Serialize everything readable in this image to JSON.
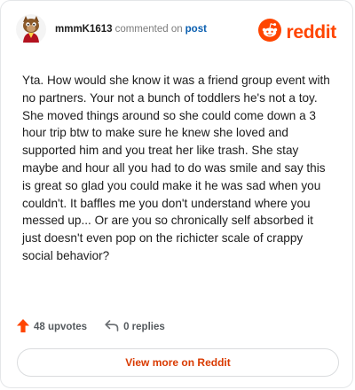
{
  "comment": {
    "author": "mmmK1613",
    "action_text": "commented on",
    "post_link": "post",
    "body": "Yta. How would she know it was a friend group event with no partners. Your not a bunch of toddlers he's not a toy. She moved things around so she could come down a 3 hour trip btw to make sure he knew she loved and supported him and you treat her like trash. She stay maybe and hour all you had to do was smile and say this is great so glad you could make it he was sad when you couldn't. It baffles me you don't understand where you messed up... Or are you so chronically self absorbed it just doesn't even pop on the richicter scale of crappy social behavior?",
    "upvotes_label": "48 upvotes",
    "replies_label": "0 replies"
  },
  "brand": {
    "wordmark": "reddit",
    "color": "#ff4500"
  },
  "actions": {
    "view_more_label": "View more on Reddit"
  },
  "icons": {
    "avatar": "avatar-icon",
    "logo": "reddit-logo-icon",
    "upvote": "upvote-arrow-icon",
    "reply": "reply-arrow-icon"
  }
}
